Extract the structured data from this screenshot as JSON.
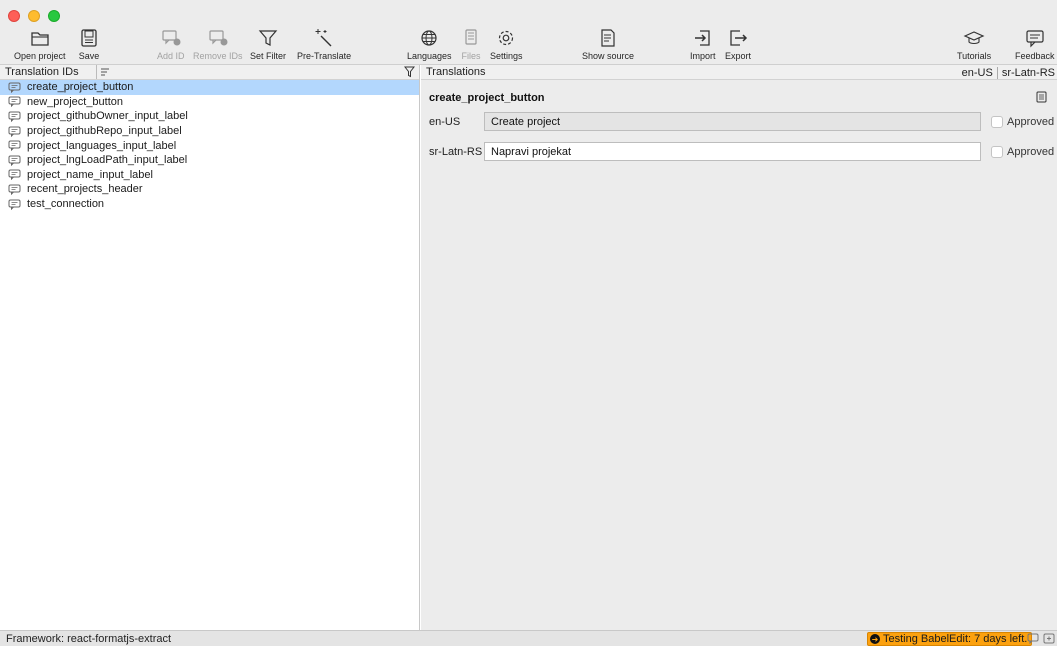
{
  "toolbar": {
    "open_project": "Open project",
    "save": "Save",
    "add_id": "Add ID",
    "remove_ids": "Remove IDs",
    "set_filter": "Set Filter",
    "pre_translate": "Pre-Translate",
    "languages": "Languages",
    "files": "Files",
    "settings": "Settings",
    "show_source": "Show source",
    "import": "Import",
    "export": "Export",
    "tutorials": "Tutorials",
    "feedback": "Feedback"
  },
  "left_panel": {
    "title": "Translation IDs",
    "items": [
      {
        "label": "create_project_button",
        "selected": true
      },
      {
        "label": "new_project_button"
      },
      {
        "label": "project_githubOwner_input_label"
      },
      {
        "label": "project_githubRepo_input_label"
      },
      {
        "label": "project_languages_input_label"
      },
      {
        "label": "project_lngLoadPath_input_label"
      },
      {
        "label": "project_name_input_label"
      },
      {
        "label": "recent_projects_header"
      },
      {
        "label": "test_connection"
      }
    ]
  },
  "right_panel": {
    "title": "Translations",
    "lang_tabs": [
      "en-US",
      "sr-Latn-RS"
    ],
    "key": "create_project_button",
    "rows": [
      {
        "lang": "en-US",
        "value": "Create project",
        "approved_label": "Approved"
      },
      {
        "lang": "sr-Latn-RS",
        "value": "Napravi projekat",
        "approved_label": "Approved"
      }
    ]
  },
  "status": {
    "framework": "Framework: react-formatjs-extract",
    "trial": "Testing BabelEdit: 7 days left."
  },
  "colors": {
    "selection": "#b3d7fd",
    "trial_badge": "#fca10f"
  }
}
